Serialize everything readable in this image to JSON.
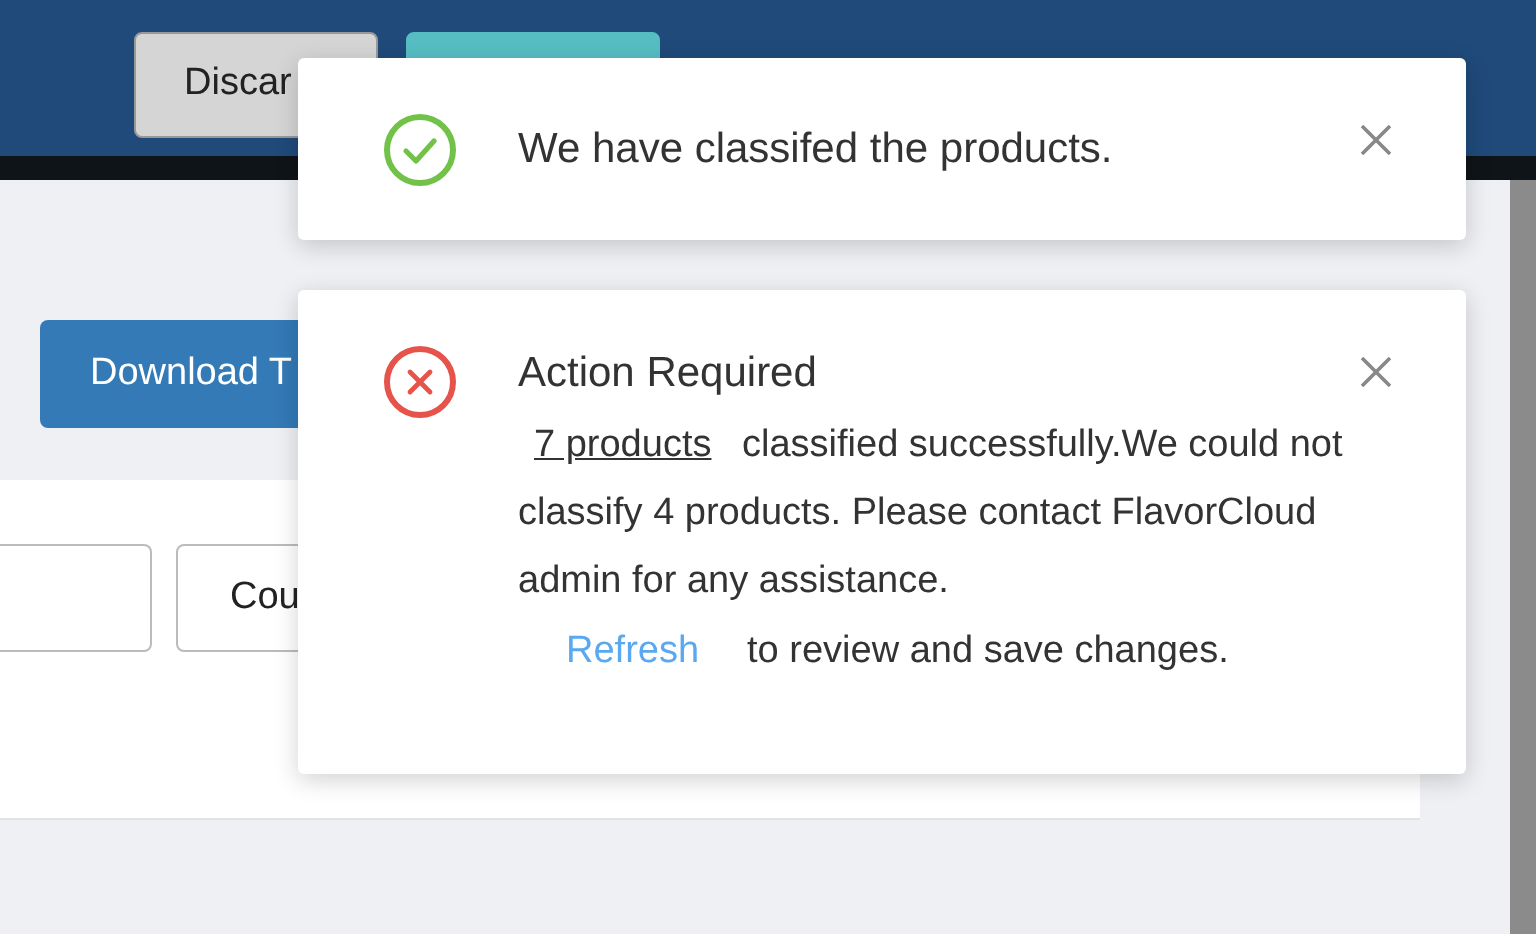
{
  "header": {
    "buttons": [
      {
        "kind": "secondary",
        "label": "Discar"
      },
      {
        "kind": "accent"
      }
    ]
  },
  "toolbar": {
    "download_button": "Download T"
  },
  "filters": [
    {
      "kind": "input"
    },
    {
      "kind": "button",
      "label": "Cou"
    }
  ],
  "notifications": [
    {
      "kind": "success",
      "message": "We have classifed the products."
    },
    {
      "kind": "error",
      "title": "Action Required",
      "link": "7 products",
      "message": "classified successfully.We could not classify 4 products. Please contact FlavorCloud admin for any assistance.",
      "action": "Refresh",
      "action_text": "to review and save changes."
    }
  ]
}
